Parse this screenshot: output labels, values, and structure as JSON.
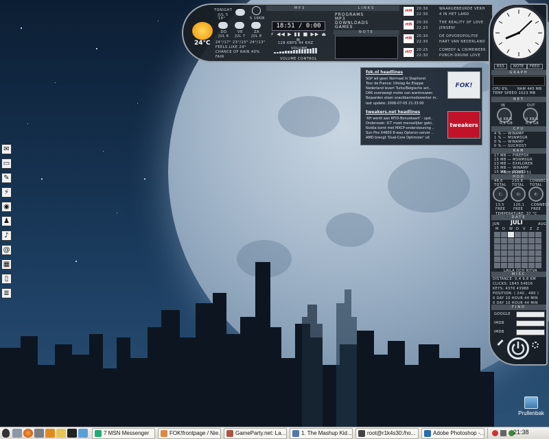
{
  "topbar": {
    "weather": {
      "header": "TONIGHT JUL 5",
      "header_sub": "19°",
      "now_temp": "24°C",
      "details": [
        "24°/17° 23°/15° 24°/13°",
        "FEELS LIKE 24°",
        "CHANCE OF RAIN 40%",
        "FAIR"
      ],
      "days": [
        {
          "label": "DO",
          "date": "JUL 6"
        },
        {
          "label": "VR",
          "date": "JUL 7"
        },
        {
          "label": "ZA",
          "date": "JUL 8"
        }
      ],
      "wind": "S 16KM"
    },
    "mp3": {
      "title": "MP3",
      "time": "18:51 / 0:00",
      "controls": "⚡ ◀◀ ▶ ▮▮ ■ ▶▶ ⏏ ≡",
      "bitrate": "128 KBPS 44 KHZ",
      "volume": "VOLUME",
      "volume_control": "VOLUME CONTROL"
    },
    "links": {
      "title": "LINKS",
      "items": [
        "PROGRAMS",
        "MP3",
        "DOWNLOADS",
        "GAMES"
      ],
      "note_title": "NOTE"
    },
    "tv": [
      {
        "channel": "rtl4",
        "times": [
          "20:30",
          "22:30"
        ],
        "shows": [
          "WAARGEBEURDE VERH",
          "4 IN HET LAND"
        ]
      },
      {
        "channel": "rtl5",
        "times": [
          "20:30",
          "22:25"
        ],
        "shows": [
          "THE REALITY OF LOVE",
          "JENSEN!"
        ]
      },
      {
        "channel": "rtl6",
        "times": [
          "20:30",
          "22:30"
        ],
        "shows": [
          "DE OPVOEDPOLITIE",
          "HART VAN NEDERLAND"
        ]
      },
      {
        "channel": "rtl7",
        "times": [
          "20:25",
          "22:30"
        ],
        "shows": [
          "COMEDY & CRIMEWEEK",
          "PUNCH-DRUNK LOVE"
        ]
      }
    ]
  },
  "news": {
    "fok_title": "fok.nl headlines",
    "fok_items": [
      "SGP wil geen Normaal in Staphorst",
      "Tour de France: Uitslag 4e Etappe",
      "Nederland levert Turks/Belgische act..",
      "D66 overweegt motie van wantrouwen",
      "Bejaarden eisen snackbarmedewerker m.."
    ],
    "last_update": "last update: 2006-07-05 21:33:00",
    "tweakers_title": "tweakers.net headlines",
    "tweakers_items": [
      "'AH werkt aan RFID-Bonuskaart' - upd..",
      "Onderzoek: ICT moet menselijker gebi..",
      "Nvidia komt met MXCP-ondersteuning ..",
      "Sun Fire X4600 8-way Opteron-server ..",
      "AMD brengt 'Dual-Core Optimizer' uit"
    ],
    "fok_logo": "FOK!",
    "tweakers_logo": "tweakers"
  },
  "sidebar": {
    "clock_labels": [
      "RSS",
      "NOTE",
      "FEED"
    ],
    "graph": "GRAPH",
    "cpu_line": "CPU 6%",
    "ram_line": "RAM 445 MB",
    "temp_line": "TEMP   SPEED 1023 MB",
    "net": "NET",
    "net_in": "IN",
    "net_out": "OUT",
    "net_in_val": "4 KB/S",
    "net_in_total": "0,5 GB",
    "net_out_val": "0 KB/S",
    "net_out_total": "0,0 GB",
    "cpu": "CPU",
    "cpu_procs": [
      "4 % — WINAMP",
      "1 % — MSNMSGR",
      "0 % — WINAMP",
      "0 % — SUCHOST",
      "0 % — OBJECTDOCK"
    ],
    "ram": "RAM",
    "ram_procs": [
      "17 MB — FIREFOX",
      "15 MB — MSNMSGR",
      "13 MB — EXPLORER",
      "15 MB — WINAMP",
      "15 MB — ZONES"
    ],
    "processes": "PROCESSES: 51",
    "hdd": "HDD",
    "hdd_top": [
      "48,8",
      "233,8",
      "CONNECT"
    ],
    "hdd_top_lbl": [
      "TOTAL",
      "TOTAL",
      "TOTAL"
    ],
    "hdd_drives": [
      "C:",
      "D:",
      "E:"
    ],
    "hdd_bottom": [
      "13,5",
      "120,1",
      "CONNECT"
    ],
    "hdd_bottom_lbl": [
      "FREE",
      "FREE",
      "FREE"
    ],
    "temperature": "TEMPERATURE: 37 °C",
    "date": "DATE",
    "month": "JULI",
    "prev_month": "JUN",
    "next_month": "AUG",
    "weekdays": [
      "M",
      "D",
      "W",
      "D",
      "V",
      "Z",
      "Z"
    ],
    "calendar_caption": "LAILA OCH RITVA",
    "misc": "MISC",
    "misc_lines": [
      "DISTANCE: 0,4    9,8 KM",
      "CLICKS: 1843    54816",
      "KEYS: 4376     43988",
      "POSITION: ( 240 , 480 )",
      "0 DAY 10 HOUR 44 MIN",
      "0 DAY 10 HOUR 44 MIN"
    ],
    "find": "FIND",
    "find_rows": [
      "GOOGLE",
      "IMDB",
      "IMDB"
    ]
  },
  "dock": {
    "icons": [
      "mail-icon",
      "monitor-icon",
      "notepad-icon",
      "lightning-icon",
      "globe-icon",
      "pawn-icon",
      "music-icon",
      "at-icon",
      "cube-icon",
      "trash-icon",
      "document-icon"
    ],
    "glyphs": [
      "✉",
      "▭",
      "✎",
      "⚡",
      "◉",
      "♟",
      "♪",
      "@",
      "▦",
      "▯",
      "≣"
    ]
  },
  "desktop": {
    "recycle_bin": "Prullenbak"
  },
  "taskbar": {
    "tasks": [
      "7 MSN Messenger",
      "FOK!frontpage / Nie...",
      "GameParty.net: La...",
      "1. The Mashup Kid...",
      "root@r1k4s30:/ho...",
      "Adobe Photoshop -..."
    ],
    "clock": "21:38"
  }
}
